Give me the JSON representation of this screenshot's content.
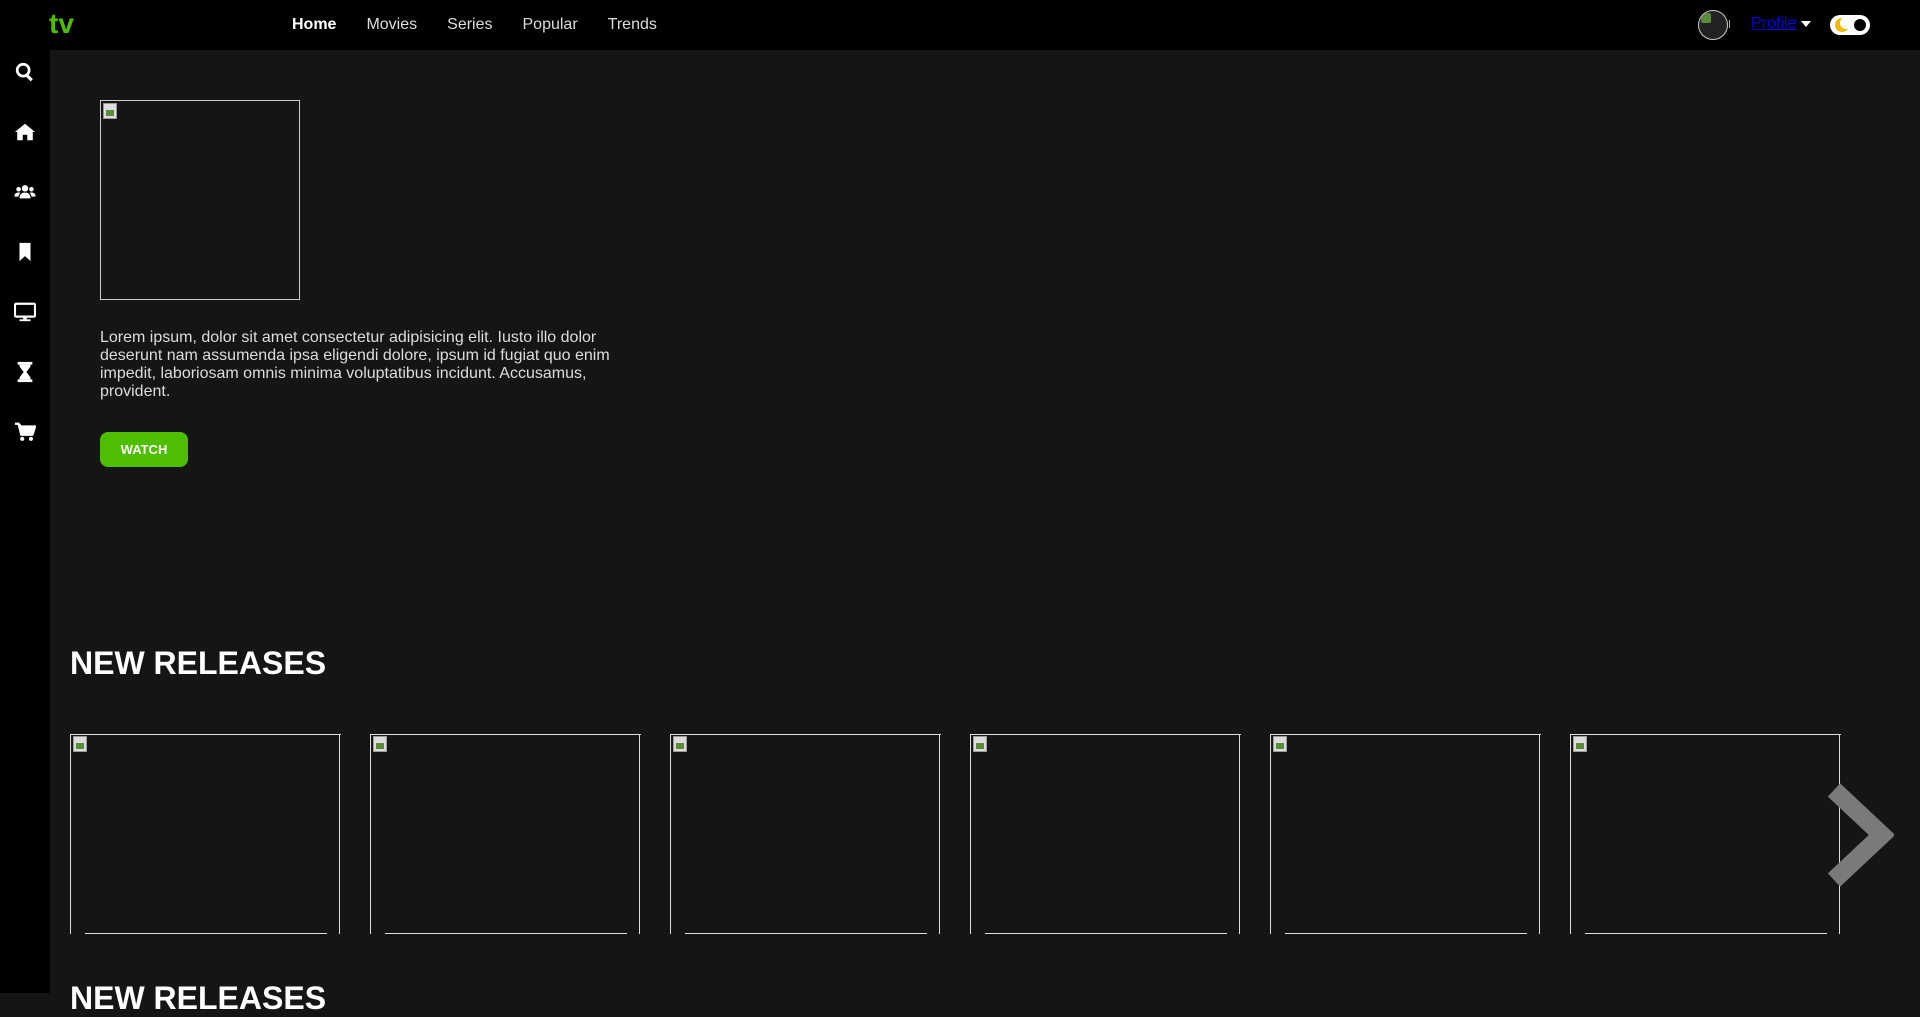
{
  "brand": {
    "logo": "tv",
    "accent": "#4dbf00"
  },
  "nav": {
    "items": [
      {
        "label": "Home",
        "active": true
      },
      {
        "label": "Movies",
        "active": false
      },
      {
        "label": "Series",
        "active": false
      },
      {
        "label": "Popular",
        "active": false
      },
      {
        "label": "Trends",
        "active": false
      }
    ]
  },
  "profile": {
    "label": "Profile",
    "theme_toggle": "dark"
  },
  "sidebar": {
    "icons": [
      "search-icon",
      "home-icon",
      "users-icon",
      "bookmark-icon",
      "tv-icon",
      "hourglass-icon",
      "cart-icon"
    ]
  },
  "hero": {
    "description": "Lorem ipsum, dolor sit amet consectetur adipisicing elit. Iusto illo dolor deserunt nam assumenda ipsa eligendi dolore, ipsum id fugiat quo enim impedit, laboriosam omnis minima voluptatibus incidunt. Accusamus, provident.",
    "button_label": "WATCH"
  },
  "sections": [
    {
      "title": "NEW RELEASES",
      "card_count": 6
    },
    {
      "title": "NEW RELEASES"
    }
  ]
}
